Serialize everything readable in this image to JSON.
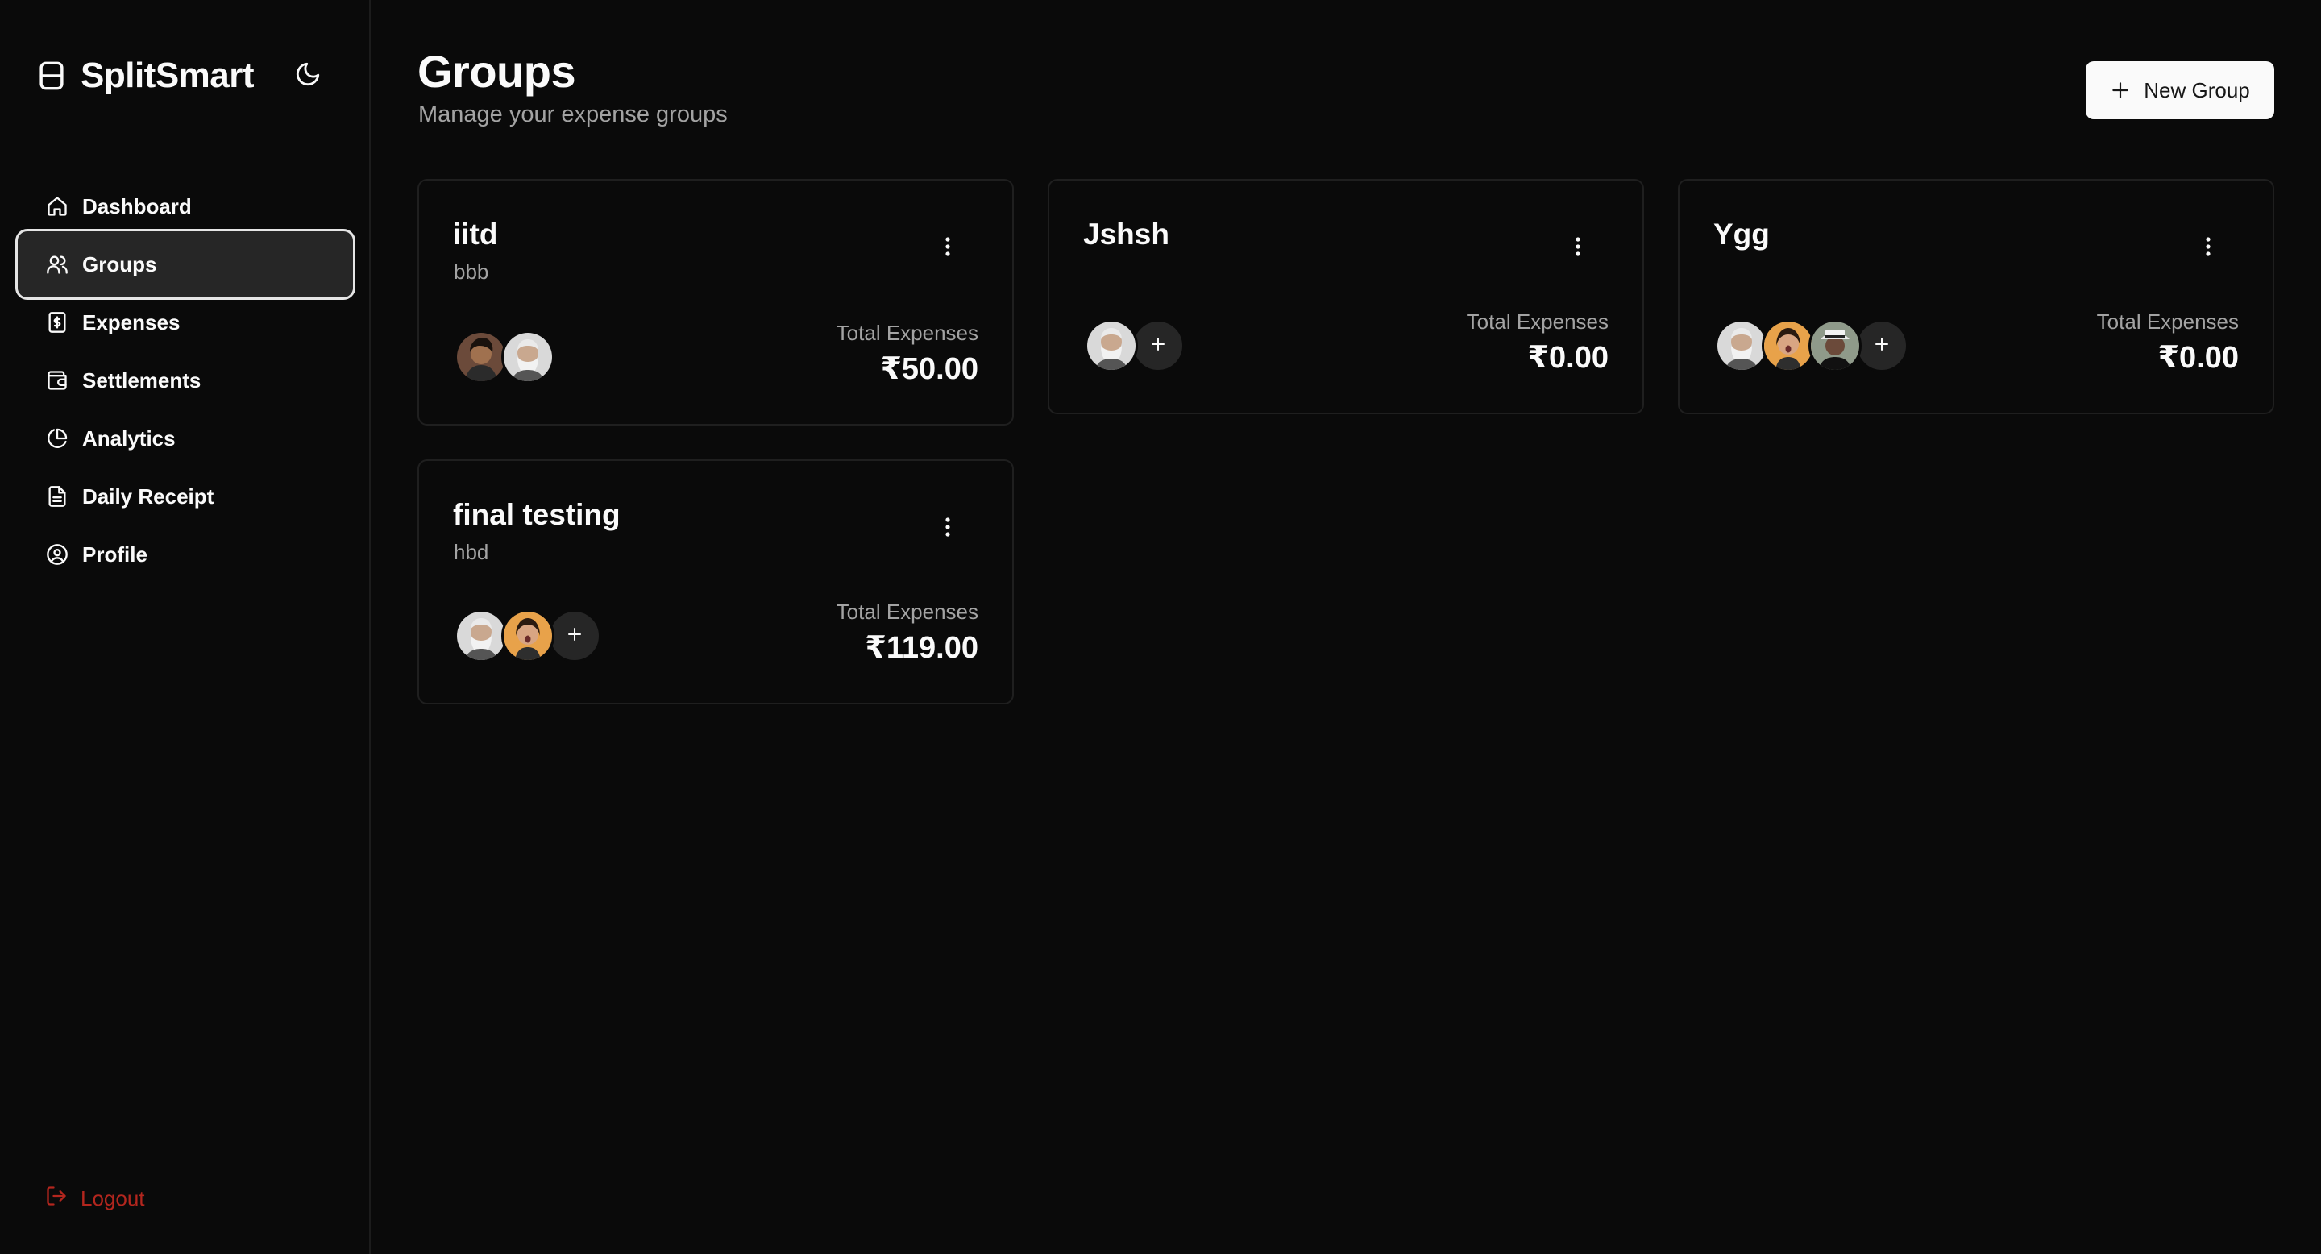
{
  "brand": {
    "name": "SplitSmart",
    "icon": "wallet-icon"
  },
  "theme_toggle": {
    "icon": "moon-icon"
  },
  "sidebar": {
    "items": [
      {
        "label": "Dashboard",
        "icon": "home-icon",
        "active": false
      },
      {
        "label": "Groups",
        "icon": "users-icon",
        "active": true
      },
      {
        "label": "Expenses",
        "icon": "receipt-dollar-icon",
        "active": false
      },
      {
        "label": "Settlements",
        "icon": "wallet-icon",
        "active": false
      },
      {
        "label": "Analytics",
        "icon": "pie-chart-icon",
        "active": false
      },
      {
        "label": "Daily Receipt",
        "icon": "file-text-icon",
        "active": false
      },
      {
        "label": "Profile",
        "icon": "user-circle-icon",
        "active": false
      }
    ],
    "logout_label": "Logout"
  },
  "header": {
    "title": "Groups",
    "subtitle": "Manage your expense groups",
    "new_group_label": "New Group"
  },
  "groups": [
    {
      "name": "iitd",
      "description": "bbb",
      "total_label": "Total Expenses",
      "total": "₹50.00",
      "members": [
        "woman-avatar",
        "old-man-avatar"
      ],
      "show_add": false
    },
    {
      "name": "Jshsh",
      "description": "",
      "total_label": "Total Expenses",
      "total": "₹0.00",
      "members": [
        "old-man-avatar"
      ],
      "show_add": true
    },
    {
      "name": "Ygg",
      "description": "",
      "total_label": "Total Expenses",
      "total": "₹0.00",
      "members": [
        "old-man-avatar",
        "surprised-woman-avatar",
        "man-hat-avatar"
      ],
      "show_add": true
    },
    {
      "name": "final testing",
      "description": "hbd",
      "total_label": "Total Expenses",
      "total": "₹119.00",
      "members": [
        "old-man-avatar",
        "surprised-woman-avatar"
      ],
      "show_add": true
    }
  ],
  "colors": {
    "background": "#0a0a0a",
    "text": "#fafafa",
    "muted": "#a3a3a3",
    "border": "#1f1f1f",
    "active_nav": "#262626",
    "logout": "#b3261e"
  }
}
